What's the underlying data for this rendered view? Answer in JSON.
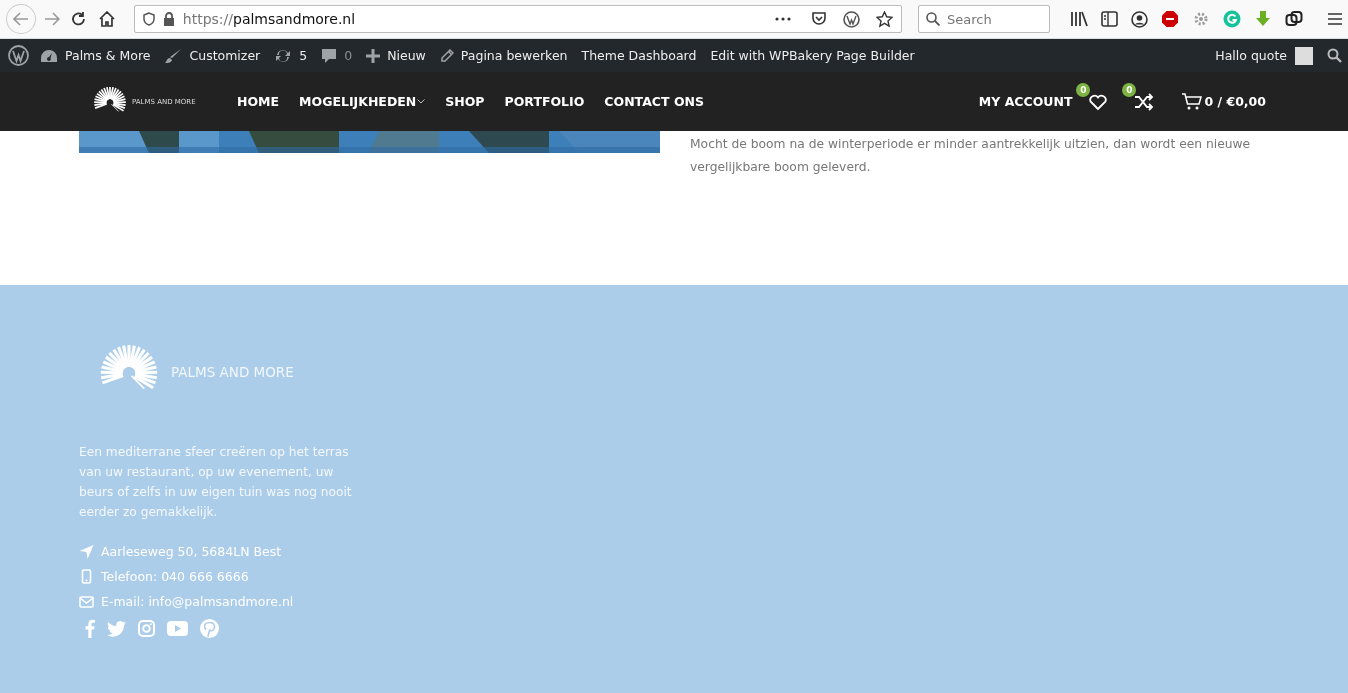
{
  "browser": {
    "url_scheme": "https://",
    "url_host": "palmsandmore.nl",
    "search": {
      "placeholder": "Search"
    }
  },
  "admin_bar": {
    "items": [
      {
        "kind": "dashboard",
        "label": "Palms & More",
        "muted": false
      },
      {
        "kind": "brush",
        "label": "Customizer",
        "muted": false
      },
      {
        "kind": "updates",
        "label": "5",
        "muted": false
      },
      {
        "kind": "comments",
        "label": "0",
        "muted": true
      },
      {
        "kind": "plus",
        "label": "Nieuw",
        "muted": false
      },
      {
        "kind": "pencil",
        "label": "Pagina bewerken",
        "muted": false
      },
      {
        "kind": "text",
        "label": "Theme Dashboard",
        "muted": false
      },
      {
        "kind": "text",
        "label": "Edit with WPBakery Page Builder",
        "muted": false
      }
    ],
    "greeting": "Hallo quote"
  },
  "header": {
    "logo_text": "PALMS AND MORE",
    "menu": [
      {
        "label": "HOME",
        "has_dropdown": false
      },
      {
        "label": "MOGELIJKHEDEN",
        "has_dropdown": true
      },
      {
        "label": "SHOP",
        "has_dropdown": false
      },
      {
        "label": "PORTFOLIO",
        "has_dropdown": false
      },
      {
        "label": "CONTACT ONS",
        "has_dropdown": false
      }
    ],
    "account": "MY ACCOUNT",
    "wishlist_count": "0",
    "compare_count": "0",
    "cart": "0 / €0,00"
  },
  "content": {
    "text": "Mocht de boom na de winterperiode er minder aantrekkelijk uitzien, dan wordt een nieuwe vergelijkbare boom geleverd."
  },
  "footer": {
    "logo_text": "PALMS AND MORE",
    "description": "Een mediterrane sfeer creëren op het terras van uw restaurant, op uw evenement, uw beurs of zelfs in uw eigen tuin was nog nooit eerder zo gemakkelijk.",
    "contacts": [
      {
        "kind": "address",
        "text": "Aarleseweg 50, 5684LN Best"
      },
      {
        "kind": "phone",
        "text": "Telefoon: 040 666 6666"
      },
      {
        "kind": "email",
        "text": "E-mail: info@palmsandmore.nl"
      }
    ],
    "social": [
      {
        "kind": "facebook"
      },
      {
        "kind": "twitter"
      },
      {
        "kind": "instagram"
      },
      {
        "kind": "youtube"
      },
      {
        "kind": "pinterest"
      }
    ]
  }
}
